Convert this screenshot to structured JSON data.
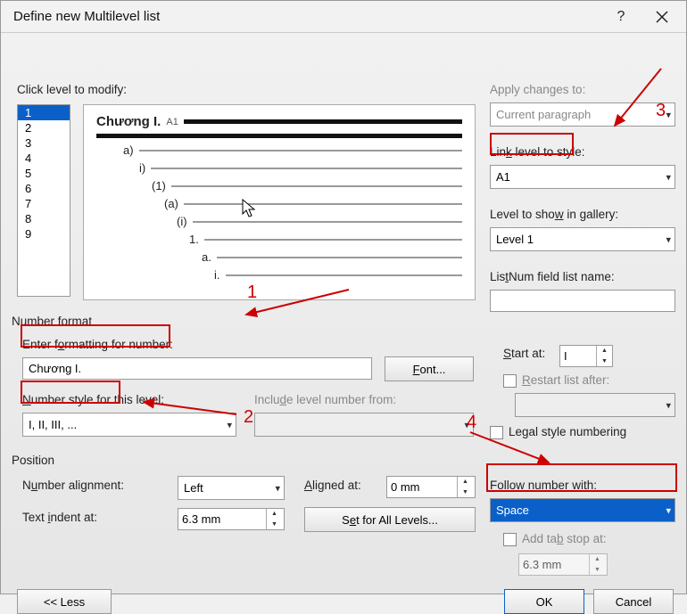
{
  "titlebar": {
    "title": "Define new Multilevel list"
  },
  "labels": {
    "click_level": "Click level to modify:",
    "apply_changes": "Apply changes to:",
    "link_level": "Link level to style:",
    "level_show": "Level to show in gallery:",
    "listnum": "ListNum field list name:",
    "number_format": "Number format",
    "enter_formatting": "Enter formatting for number:",
    "font_btn": "Font...",
    "number_style": "Number style for this level:",
    "include_level": "Include level number from:",
    "start_at": "Start at:",
    "restart_after": "Restart list after:",
    "legal_style": "Legal style numbering",
    "position": "Position",
    "num_alignment": "Number alignment:",
    "aligned_at": "Aligned at:",
    "follow_number": "Follow number with:",
    "text_indent": "Text indent at:",
    "set_all": "Set for All Levels...",
    "add_tab": "Add tab stop at:",
    "less": "<< Less",
    "ok": "OK",
    "cancel": "Cancel"
  },
  "values": {
    "apply_changes": "Current paragraph",
    "link_level": "A1",
    "level_show": "Level 1",
    "listnum": "",
    "formatting": "Chương I.",
    "number_style": "I, II, III, ...",
    "include_level": "",
    "start_at": "I",
    "num_alignment": "Left",
    "aligned_at": "0 mm",
    "follow_number": "Space",
    "text_indent": "6.3 mm",
    "tab_stop": "6.3 mm"
  },
  "levels": [
    "1",
    "2",
    "3",
    "4",
    "5",
    "6",
    "7",
    "8",
    "9"
  ],
  "selected_level": "1",
  "preview": {
    "l1": "Chương I.",
    "l1b": "A1",
    "l2": "a)",
    "l3": "i)",
    "l4": "(1)",
    "l5": "(a)",
    "l6": "(i)",
    "l7": "1.",
    "l8": "a.",
    "l9": "i."
  },
  "annotations": {
    "n1": "1",
    "n2": "2",
    "n3": "3",
    "n4": "4"
  }
}
